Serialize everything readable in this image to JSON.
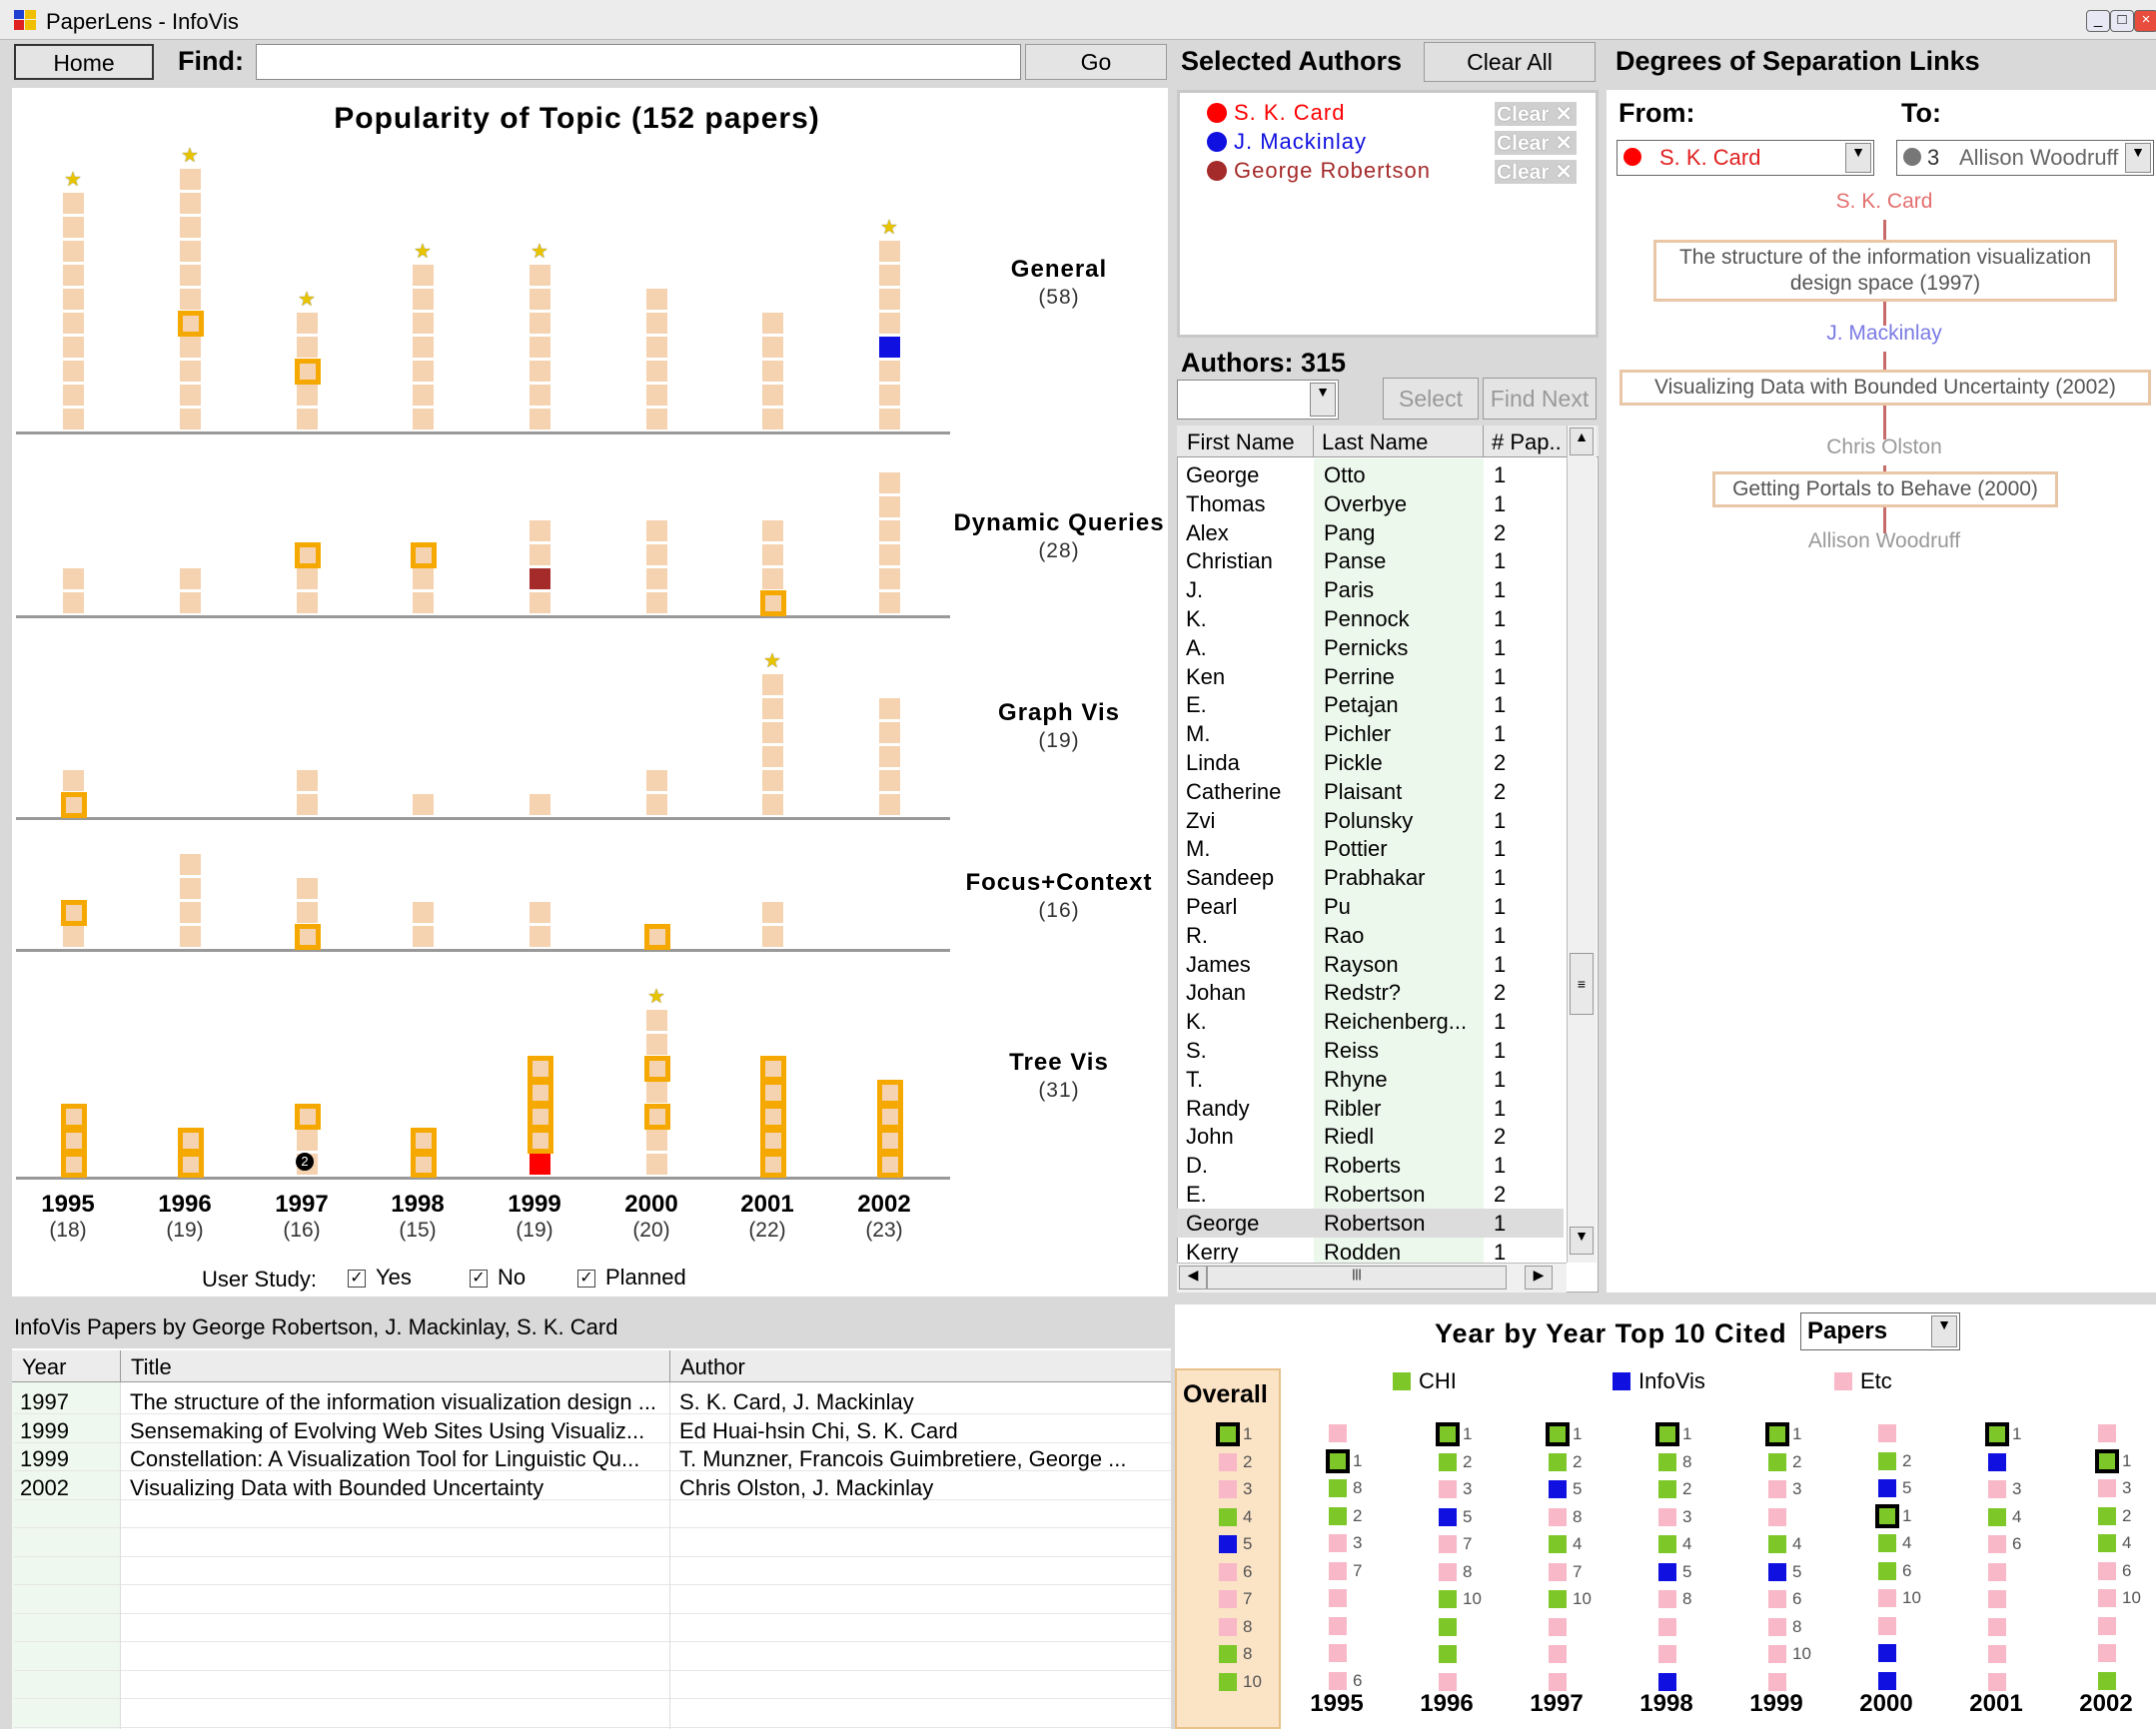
{
  "window": {
    "title": "PaperLens - InfoVis"
  },
  "toolbar": {
    "home_label": "Home",
    "find_label": "Find:",
    "find_value": "",
    "go_label": "Go"
  },
  "popularity": {
    "title": "Popularity of Topic (152 papers)",
    "years": [
      {
        "year": "1995",
        "count": "(18)"
      },
      {
        "year": "1996",
        "count": "(19)"
      },
      {
        "year": "1997",
        "count": "(16)"
      },
      {
        "year": "1998",
        "count": "(15)"
      },
      {
        "year": "1999",
        "count": "(19)"
      },
      {
        "year": "2000",
        "count": "(20)"
      },
      {
        "year": "2001",
        "count": "(22)"
      },
      {
        "year": "2002",
        "count": "(23)"
      }
    ],
    "topics": [
      {
        "name": "General",
        "count": "(58)",
        "bars": [
          10,
          11,
          5,
          7,
          7,
          6,
          5,
          8
        ],
        "stars": [
          1,
          1,
          1,
          1,
          1,
          0,
          0,
          1
        ],
        "orange": [
          [],
          [
            4
          ],
          [
            2
          ],
          [],
          [],
          [],
          [],
          []
        ],
        "red_marks": [],
        "blue_marks": [
          [
            7,
            3
          ]
        ],
        "number_badges": []
      },
      {
        "name": "Dynamic Queries",
        "count": "(28)",
        "bars": [
          2,
          2,
          3,
          3,
          4,
          4,
          4,
          6
        ],
        "stars": [
          0,
          0,
          0,
          0,
          0,
          0,
          0,
          0
        ],
        "orange": [
          [],
          [],
          [
            2
          ],
          [
            2
          ],
          [],
          [],
          [
            0
          ],
          []
        ],
        "red_marks": [
          [
            4,
            1
          ]
        ],
        "blue_marks": [],
        "number_badges": []
      },
      {
        "name": "Graph Vis",
        "count": "(19)",
        "bars": [
          2,
          0,
          2,
          1,
          1,
          2,
          6,
          5
        ],
        "stars": [
          0,
          0,
          0,
          0,
          0,
          0,
          1,
          0
        ],
        "orange": [
          [
            0
          ],
          [],
          [],
          [],
          [],
          [],
          [],
          []
        ],
        "red_marks": [],
        "blue_marks": [],
        "number_badges": []
      },
      {
        "name": "Focus+Context",
        "count": "(16)",
        "bars": [
          2,
          4,
          3,
          2,
          2,
          1,
          2,
          0
        ],
        "stars": [
          0,
          0,
          0,
          0,
          0,
          0,
          0,
          0
        ],
        "orange": [
          [
            1
          ],
          [],
          [
            0
          ],
          [],
          [],
          [
            0
          ],
          [],
          []
        ],
        "red_marks": [],
        "blue_marks": [],
        "number_badges": []
      },
      {
        "name": "Tree Vis",
        "count": "(31)",
        "bars": [
          3,
          2,
          3,
          2,
          5,
          7,
          5,
          4
        ],
        "stars": [
          0,
          0,
          0,
          0,
          0,
          1,
          0,
          0
        ],
        "orange": [
          [
            0,
            1,
            2
          ],
          [
            0,
            1
          ],
          [
            2
          ],
          [
            0,
            1
          ],
          [
            1,
            2,
            3,
            4
          ],
          [
            2,
            4
          ],
          [
            0,
            1,
            2,
            3,
            4
          ],
          [
            0,
            1,
            2,
            3
          ]
        ],
        "red_marks": [
          [
            4,
            0
          ]
        ],
        "blue_marks": [],
        "number_badges": [
          [
            2,
            0,
            "2"
          ]
        ]
      }
    ],
    "user_study_label": "User Study:",
    "user_study_options": [
      {
        "label": "Yes",
        "checked": true
      },
      {
        "label": "No",
        "checked": true
      },
      {
        "label": "Planned",
        "checked": true
      }
    ]
  },
  "selected_authors": {
    "title": "Selected Authors",
    "clear_all_label": "Clear All",
    "clear_label": "Clear",
    "authors": [
      {
        "name": "S. K. Card",
        "color": "#ff0000"
      },
      {
        "name": "J. Mackinlay",
        "color": "#1010e0"
      },
      {
        "name": "George Robertson",
        "color": "#a52a2a"
      }
    ]
  },
  "authors": {
    "title": "Authors: 315",
    "select_label": "Select",
    "find_next_label": "Find Next",
    "combo_value": "",
    "columns": [
      "First Name",
      "Last Name",
      "# Pap.."
    ],
    "rows": [
      [
        "George",
        "Otto",
        "1"
      ],
      [
        "Thomas",
        "Overbye",
        "1"
      ],
      [
        "Alex",
        "Pang",
        "2"
      ],
      [
        "Christian",
        "Panse",
        "1"
      ],
      [
        "J.",
        "Paris",
        "1"
      ],
      [
        "K.",
        "Pennock",
        "1"
      ],
      [
        "A.",
        "Pernicks",
        "1"
      ],
      [
        "Ken",
        "Perrine",
        "1"
      ],
      [
        "E.",
        "Petajan",
        "1"
      ],
      [
        "M.",
        "Pichler",
        "1"
      ],
      [
        "Linda",
        "Pickle",
        "2"
      ],
      [
        "Catherine",
        "Plaisant",
        "2"
      ],
      [
        "Zvi",
        "Polunsky",
        "1"
      ],
      [
        "M.",
        "Pottier",
        "1"
      ],
      [
        "Sandeep",
        "Prabhakar",
        "1"
      ],
      [
        "Pearl",
        "Pu",
        "1"
      ],
      [
        "R.",
        "Rao",
        "1"
      ],
      [
        "James",
        "Rayson",
        "1"
      ],
      [
        "Johan",
        "Redstr?",
        "2"
      ],
      [
        "K.",
        "Reichenberg...",
        "1"
      ],
      [
        "S.",
        "Reiss",
        "1"
      ],
      [
        "T.",
        "Rhyne",
        "1"
      ],
      [
        "Randy",
        "Ribler",
        "1"
      ],
      [
        "John",
        "Riedl",
        "2"
      ],
      [
        "D.",
        "Roberts",
        "1"
      ],
      [
        "E.",
        "Robertson",
        "2"
      ],
      [
        "George",
        "Robertson",
        "1"
      ],
      [
        "Kerry",
        "Rodden",
        "1"
      ]
    ]
  },
  "degrees": {
    "title": "Degrees of Separation Links",
    "from_label": "From:",
    "to_label": "To:",
    "from_value": "S. K. Card",
    "to_count": "3",
    "to_value": "Allison Woodruff",
    "chain": [
      {
        "kind": "author",
        "text": "S. K. Card",
        "color": "#e46f6f"
      },
      {
        "kind": "paper",
        "text": "The structure of the information visualization design space (1997)"
      },
      {
        "kind": "author",
        "text": "J. Mackinlay",
        "color": "#7a7ae6"
      },
      {
        "kind": "paper",
        "text": "Visualizing Data with Bounded Uncertainty (2002)"
      },
      {
        "kind": "author",
        "text": "Chris Olston",
        "color": "#999999"
      },
      {
        "kind": "paper",
        "text": "Getting Portals to Behave (2000)"
      },
      {
        "kind": "author",
        "text": "Allison Woodruff",
        "color": "#999999"
      }
    ]
  },
  "papers": {
    "title": "InfoVis Papers by George Robertson, J. Mackinlay, S. K. Card",
    "columns": [
      "Year",
      "Title",
      "Author"
    ],
    "rows": [
      [
        "1997",
        "The structure of the information visualization design ...",
        "S. K. Card, J. Mackinlay"
      ],
      [
        "1999",
        "Sensemaking of Evolving Web Sites Using Visualiz...",
        "Ed Huai-hsin Chi, S. K. Card"
      ],
      [
        "1999",
        "Constellation: A Visualization Tool for Linguistic Qu...",
        "T. Munzner, Francois Guimbretiere, George ..."
      ],
      [
        "2002",
        "Visualizing Data with Bounded Uncertainty",
        "Chris Olston, J. Mackinlay"
      ]
    ]
  },
  "top_cited": {
    "title": "Year by Year Top 10 Cited",
    "mode_value": "Papers",
    "legend": [
      {
        "name": "CHI",
        "color": "#7dc828"
      },
      {
        "name": "InfoVis",
        "color": "#1010e0"
      },
      {
        "name": "Etc",
        "color": "#f8b8c8"
      }
    ],
    "overall_label": "Overall",
    "overall": [
      [
        "chi",
        "1",
        1
      ],
      [
        "etc",
        "2",
        0
      ],
      [
        "etc",
        "3",
        0
      ],
      [
        "chi",
        "4",
        0
      ],
      [
        "infovis",
        "5",
        0
      ],
      [
        "etc",
        "6",
        0
      ],
      [
        "etc",
        "7",
        0
      ],
      [
        "etc",
        "8",
        0
      ],
      [
        "chi",
        "8",
        0
      ],
      [
        "chi",
        "10",
        0
      ]
    ],
    "years": [
      {
        "year": "1995",
        "items": [
          [
            "etc",
            "",
            0
          ],
          [
            "chi",
            "1",
            1
          ],
          [
            "chi",
            "8",
            0
          ],
          [
            "chi",
            "2",
            0
          ],
          [
            "etc",
            "3",
            0
          ],
          [
            "etc",
            "7",
            0
          ],
          [
            "etc",
            "",
            0
          ],
          [
            "etc",
            "",
            0
          ],
          [
            "etc",
            "",
            0
          ],
          [
            "etc",
            "6",
            0
          ]
        ]
      },
      {
        "year": "1996",
        "items": [
          [
            "chi",
            "1",
            1
          ],
          [
            "chi",
            "2",
            0
          ],
          [
            "etc",
            "3",
            0
          ],
          [
            "infovis",
            "5",
            0
          ],
          [
            "etc",
            "7",
            0
          ],
          [
            "etc",
            "8",
            0
          ],
          [
            "chi",
            "10",
            0
          ],
          [
            "chi",
            "",
            0
          ],
          [
            "chi",
            "",
            0
          ],
          [
            "etc",
            "",
            0
          ]
        ]
      },
      {
        "year": "1997",
        "items": [
          [
            "chi",
            "1",
            1
          ],
          [
            "chi",
            "2",
            0
          ],
          [
            "infovis",
            "5",
            0
          ],
          [
            "etc",
            "8",
            0
          ],
          [
            "chi",
            "4",
            0
          ],
          [
            "etc",
            "7",
            0
          ],
          [
            "chi",
            "10",
            0
          ],
          [
            "etc",
            "",
            0
          ],
          [
            "etc",
            "",
            0
          ],
          [
            "etc",
            "",
            0
          ]
        ]
      },
      {
        "year": "1998",
        "items": [
          [
            "chi",
            "1",
            1
          ],
          [
            "chi",
            "8",
            0
          ],
          [
            "chi",
            "2",
            0
          ],
          [
            "etc",
            "3",
            0
          ],
          [
            "chi",
            "4",
            0
          ],
          [
            "infovis",
            "5",
            0
          ],
          [
            "etc",
            "8",
            0
          ],
          [
            "etc",
            "",
            0
          ],
          [
            "etc",
            "",
            0
          ],
          [
            "infovis",
            "",
            0
          ]
        ]
      },
      {
        "year": "1999",
        "items": [
          [
            "chi",
            "1",
            1
          ],
          [
            "chi",
            "2",
            0
          ],
          [
            "etc",
            "3",
            0
          ],
          [
            "etc",
            "",
            0
          ],
          [
            "chi",
            "4",
            0
          ],
          [
            "infovis",
            "5",
            0
          ],
          [
            "etc",
            "6",
            0
          ],
          [
            "etc",
            "8",
            0
          ],
          [
            "etc",
            "10",
            0
          ],
          [
            "etc",
            "",
            0
          ]
        ]
      },
      {
        "year": "2000",
        "items": [
          [
            "etc",
            "",
            0
          ],
          [
            "chi",
            "2",
            0
          ],
          [
            "infovis",
            "5",
            0
          ],
          [
            "chi",
            "1",
            1
          ],
          [
            "chi",
            "4",
            0
          ],
          [
            "chi",
            "6",
            0
          ],
          [
            "etc",
            "10",
            0
          ],
          [
            "etc",
            "",
            0
          ],
          [
            "infovis",
            "",
            0
          ],
          [
            "infovis",
            "",
            0
          ]
        ]
      },
      {
        "year": "2001",
        "items": [
          [
            "chi",
            "1",
            1
          ],
          [
            "infovis",
            "",
            0
          ],
          [
            "etc",
            "3",
            0
          ],
          [
            "chi",
            "4",
            0
          ],
          [
            "etc",
            "6",
            0
          ],
          [
            "etc",
            "",
            0
          ],
          [
            "etc",
            "",
            0
          ],
          [
            "etc",
            "",
            0
          ],
          [
            "etc",
            "",
            0
          ],
          [
            "etc",
            "",
            0
          ]
        ]
      },
      {
        "year": "2002",
        "items": [
          [
            "etc",
            "",
            0
          ],
          [
            "chi",
            "1",
            1
          ],
          [
            "etc",
            "3",
            0
          ],
          [
            "chi",
            "2",
            0
          ],
          [
            "chi",
            "4",
            0
          ],
          [
            "etc",
            "6",
            0
          ],
          [
            "etc",
            "10",
            0
          ],
          [
            "etc",
            "",
            0
          ],
          [
            "etc",
            "",
            0
          ],
          [
            "chi",
            "",
            0
          ]
        ]
      }
    ]
  }
}
